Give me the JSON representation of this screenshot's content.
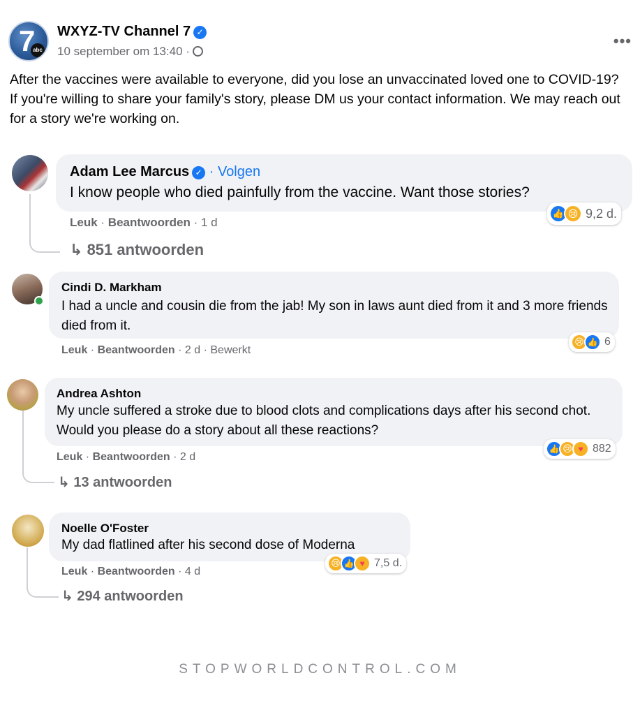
{
  "post": {
    "page_name": "WXYZ-TV Channel 7",
    "avatar_text": "7",
    "avatar_badge": "abc",
    "verified_icon": "✓",
    "date": "10 september om 13:40 ·",
    "more_icon": "•••",
    "text": "After the vaccines were available to everyone, did you lose an unvaccinated loved one to COVID-19? If you're willing to share your family's story, please DM us your contact information. We may reach out for a story we're working on."
  },
  "labels": {
    "like": "Leuk",
    "reply": "Beantwoorden",
    "sep": " · "
  },
  "comments": [
    {
      "author": "Adam Lee Marcus",
      "follow": "· Volgen",
      "text": "I know people who died painfully from the vaccine. Want those stories?",
      "time": "1 d",
      "reaction_count": "9,2 d.",
      "replies": "851 antwoorden"
    },
    {
      "author": "Cindi D. Markham",
      "text": "I had a uncle and cousin die from the jab! My son in laws aunt died from it and 3 more friends died from it.",
      "time": "2 d",
      "edited": "Bewerkt",
      "reaction_count": "6"
    },
    {
      "author": "Andrea Ashton",
      "text": "My uncle suffered a stroke due to blood clots and complications days after his second chot. Would you please do a story about all these reactions?",
      "time": "2 d",
      "reaction_count": "882",
      "replies": "13 antwoorden"
    },
    {
      "author": "Noelle O'Foster",
      "text": "My dad flatlined after his second dose of Moderna",
      "time": "4 d",
      "reaction_count": "7,5 d.",
      "replies": "294 antwoorden"
    }
  ],
  "reply_arrow": "↳",
  "footer": "STOPWORLDCONTROL.COM",
  "colors": {
    "link_blue": "#1877f2",
    "bubble_bg": "#f0f2f5",
    "muted_text": "#65676b",
    "sad_yellow": "#f7b125",
    "online_green": "#31a24c"
  }
}
